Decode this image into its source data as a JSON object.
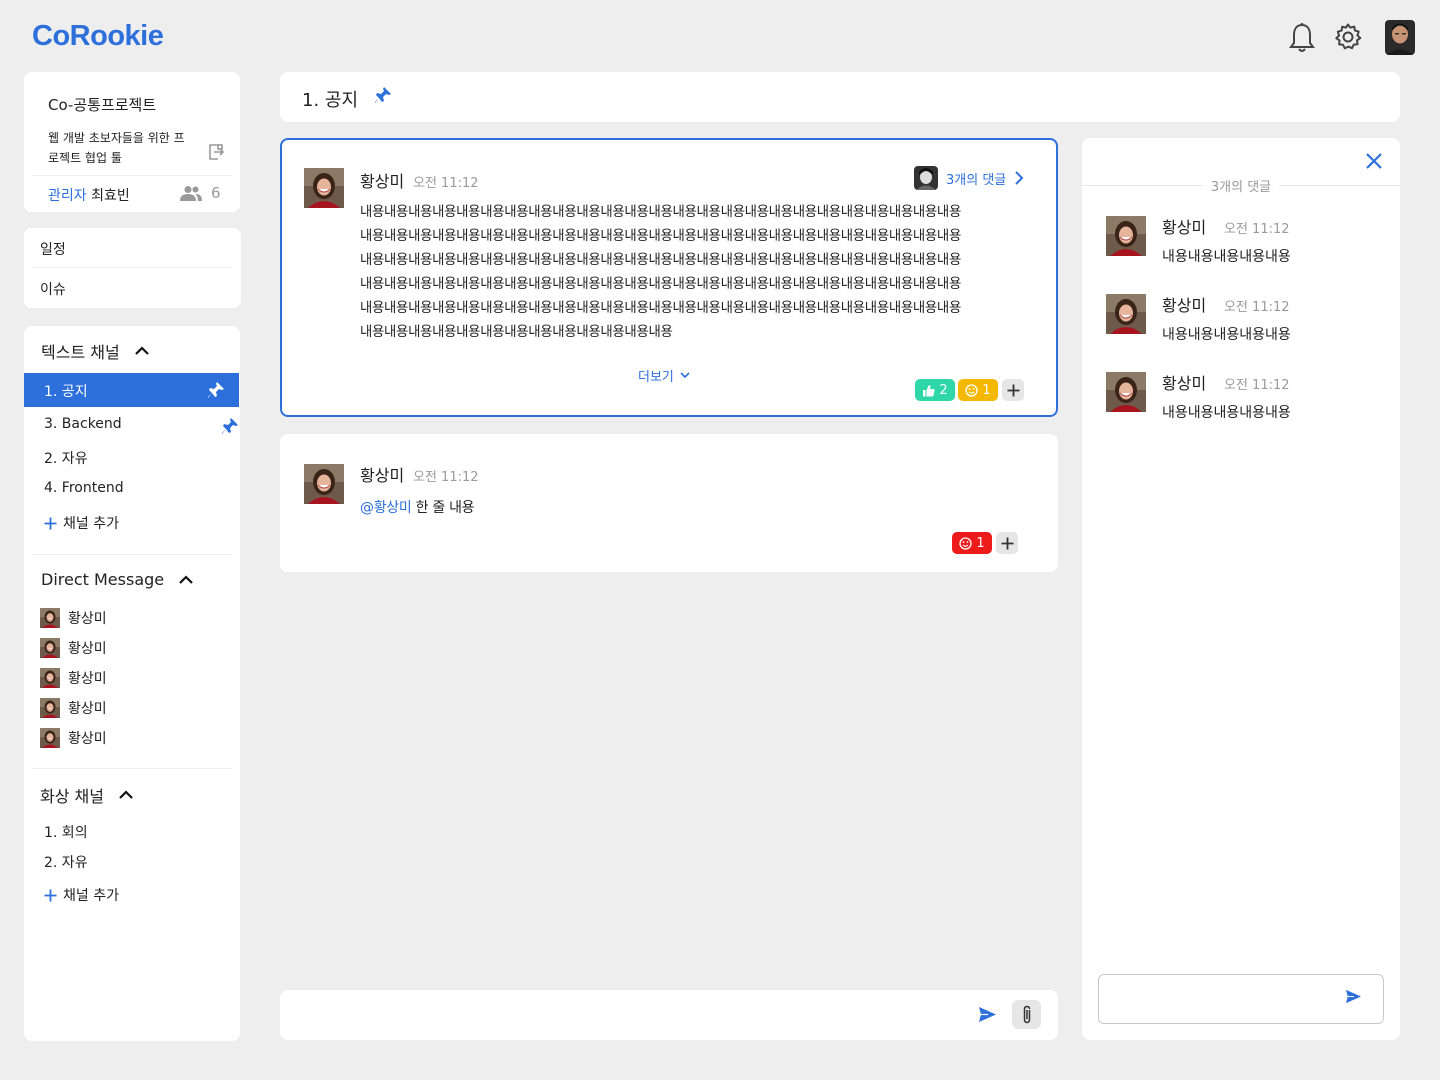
{
  "app": {
    "logo": "CoRookie"
  },
  "topbar": {
    "notifications_icon": "bell-icon",
    "settings_icon": "gear-icon",
    "profile_icon": "user-avatar"
  },
  "project": {
    "name": "Co-공통프로젝트",
    "description": "웹 개발 초보자들을 위한 프로젝트 협업 툴",
    "admin_label": "관리자",
    "admin_name": "최효빈",
    "member_count": "6"
  },
  "nav": {
    "items": [
      {
        "label": "일정"
      },
      {
        "label": "이슈"
      }
    ]
  },
  "text_channels": {
    "title": "텍스트 채널",
    "items": [
      {
        "label": "1. 공지",
        "pinned": true,
        "active": true
      },
      {
        "label": "3. Backend",
        "pinned": true
      },
      {
        "label": "2. 자유"
      },
      {
        "label": "4. Frontend"
      }
    ],
    "add_label": "채널 추가"
  },
  "direct_messages": {
    "title": "Direct Message",
    "items": [
      {
        "name": "황상미"
      },
      {
        "name": "황상미"
      },
      {
        "name": "황상미"
      },
      {
        "name": "황상미"
      },
      {
        "name": "황상미"
      }
    ]
  },
  "video_channels": {
    "title": "화상 채널",
    "items": [
      {
        "label": "1. 회의"
      },
      {
        "label": "2. 자유"
      }
    ],
    "add_label": "채널 추가"
  },
  "channel_header": {
    "title": "1. 공지"
  },
  "messages": [
    {
      "author": "황상미",
      "time": "오전 11:12",
      "body": "내용내용내용내용내용내용내용내용내용내용내용내용내용내용내용내용내용내용내용내용내용내용내용내용내용내용내용내용내용내용내용내용내용내용내용내용내용내용내용내용내용내용내용내용내용내용내용내용내용내용내용내용내용내용내용내용내용내용내용내용내용내용내용내용내용내용내용내용내용내용내용내용내용내용내용내용내용내용내용내용내용내용내용내용내용내용내용내용내용내용내용내용내용내용내용내용내용내용내용내용내용내용내용내용내용내용내용내용내용내용내용내용내용내용내용내용내용내용내용내용내용내용내용내용내용내용내용내용내용내용내용내용내용내용내용내용내용내용",
      "reply_label": "3개의 댓글",
      "more_label": "더보기",
      "reactions": [
        {
          "icon": "thumbs-up-icon",
          "count": "2",
          "color": "#2fd6a7"
        },
        {
          "icon": "smile-icon",
          "count": "1",
          "color": "#f5b800"
        }
      ]
    },
    {
      "author": "황상미",
      "time": "오전 11:12",
      "mention": "@황상미",
      "body": "한 줄 내용",
      "reactions": [
        {
          "icon": "smile-icon",
          "count": "1",
          "color": "#ee1b1b"
        }
      ]
    }
  ],
  "composer": {
    "value": "",
    "send_icon": "send-icon",
    "attach_icon": "paperclip-icon"
  },
  "thread": {
    "count_label": "3개의 댓글",
    "comments": [
      {
        "author": "황상미",
        "time": "오전 11:12",
        "body": "내용내용내용내용내용"
      },
      {
        "author": "황상미",
        "time": "오전 11:12",
        "body": "내용내용내용내용내용"
      },
      {
        "author": "황상미",
        "time": "오전 11:12",
        "body": "내용내용내용내용내용"
      }
    ],
    "input_value": ""
  },
  "colors": {
    "accent": "#2d6fdb",
    "background": "#eeeeee",
    "card": "#ffffff"
  }
}
